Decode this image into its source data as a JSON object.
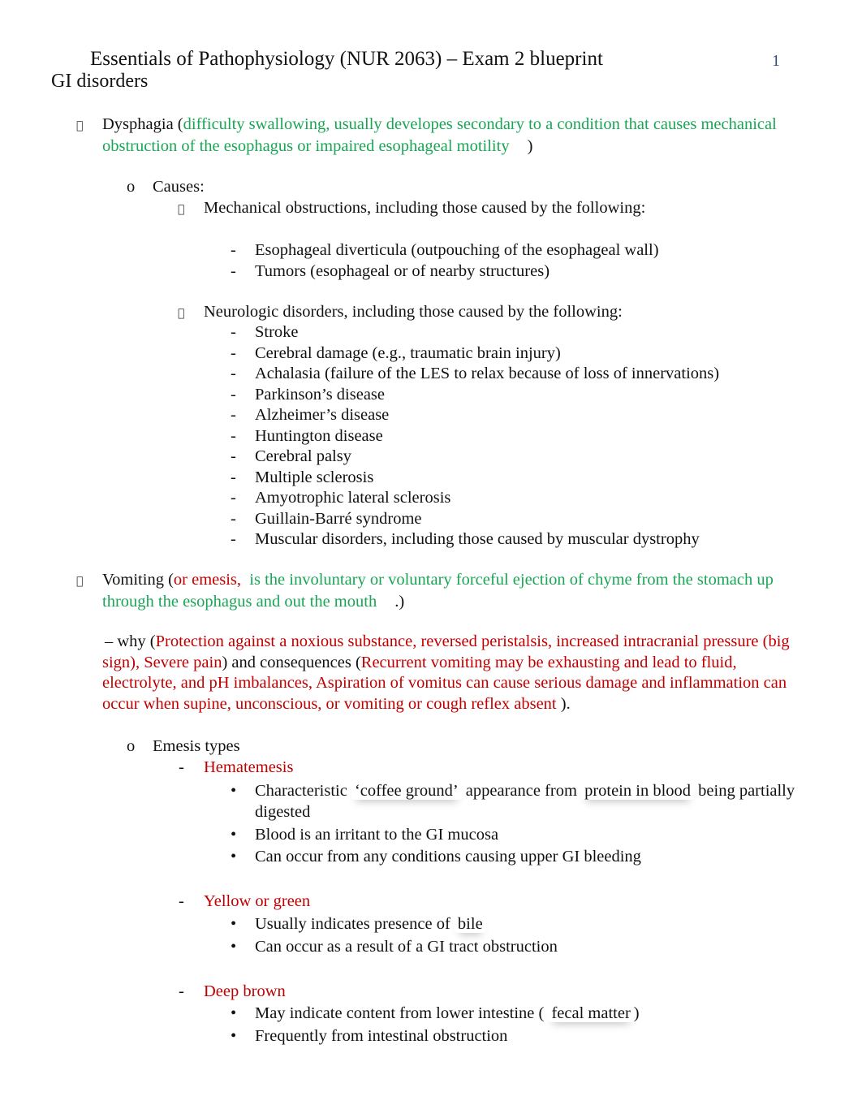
{
  "header": {
    "title": "Essentials of Pathophysiology (NUR 2063) – Exam 2 blueprint",
    "page_number": "1",
    "section": "GI disorders"
  },
  "bullet_glyph": "",
  "dysphagia": {
    "term": "Dysphagia (",
    "definition": "difficulty swallowing, usually developes secondary to a condition that causes mechanical",
    "definition_line2": "obstruction of the esophagus or impaired esophageal motility",
    "close": ")",
    "causes_marker": "o",
    "causes_label": "Causes:",
    "mechanical": {
      "label": "Mechanical obstructions, including those caused by the following:",
      "items": [
        "Esophageal diverticula (outpouching of the esophageal wall)",
        "Tumors (esophageal or of nearby structures)"
      ]
    },
    "neurologic": {
      "label": "Neurologic disorders, including those caused by the following:",
      "items": [
        "Stroke",
        "Cerebral damage (e.g., traumatic brain injury)",
        "Achalasia (failure of the LES to relax because of loss of innervations)",
        "Parkinson’s disease",
        "Alzheimer’s disease",
        "Huntington disease",
        "Cerebral palsy",
        "Multiple sclerosis",
        "Amyotrophic lateral sclerosis",
        "Guillain-Barré syndrome",
        "Muscular disorders, including those caused by muscular dystrophy"
      ]
    }
  },
  "vomiting": {
    "term": "Vomiting (",
    "alt": "or emesis,",
    "definition": "is the involuntary or voluntary forceful ejection of chyme from the stomach up",
    "definition_line2": "through the esophagus and out the mouth",
    "close": ".)",
    "why_prefix": "– why (",
    "why_text": "Protection against a noxious substance, reversed peristalsis, increased intracranial pressure (big sign), Severe pain",
    "consequences_prefix": ") and consequences  (",
    "consequences_text": "Recurrent vomiting may be exhausting and lead to fluid, electrolyte, and pH imbalances, Aspiration of vomitus can cause serious damage and inflammation can occur when supine, unconscious, or vomiting or cough reflex absent",
    "end": " ).",
    "types_marker": "o",
    "types_label": "Emesis types",
    "types": [
      {
        "name": "Hematemesis",
        "points": [
          {
            "pre": "Characteristic ",
            "hl1": "‘coffee ground’",
            "mid": " appearance from ",
            "hl2": "protein in blood",
            "post": " being partially"
          },
          {
            "text": "digested"
          },
          {
            "text": "Blood is an irritant to the GI mucosa"
          },
          {
            "text": "Can occur from any conditions causing upper GI bleeding"
          }
        ]
      },
      {
        "name": "Yellow or green",
        "points": [
          {
            "pre": "Usually indicates presence of ",
            "hl1": "bile"
          },
          {
            "text": "Can occur as a result of a GI tract obstruction"
          }
        ]
      },
      {
        "name": "Deep brown",
        "points": [
          {
            "pre": "May indicate content from lower intestine ( ",
            "hl1": "fecal matter",
            "post": ")"
          },
          {
            "text": "Frequently from intestinal obstruction"
          }
        ]
      }
    ]
  },
  "colors": {
    "definition_green": "#1aa556",
    "emphasis_red": "#c00000",
    "page_number_blue": "#2e4a7a"
  }
}
